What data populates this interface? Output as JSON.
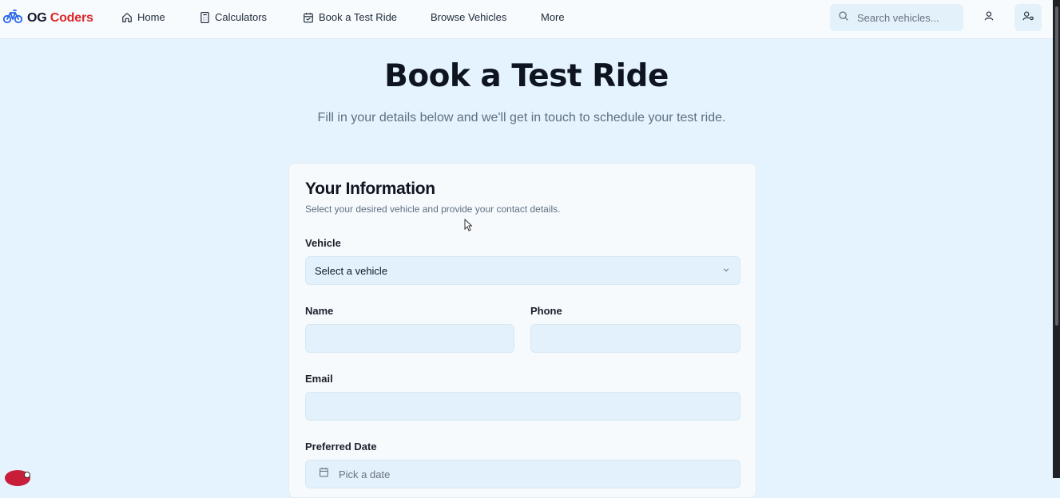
{
  "brand": {
    "part1": "OG",
    "part2": "Coders",
    "icon": "bicycle-icon",
    "accent": "#dc2626",
    "icon_color": "#2563eb"
  },
  "nav": {
    "items": [
      {
        "label": "Home",
        "icon": "home-icon"
      },
      {
        "label": "Calculators",
        "icon": "calculator-icon"
      },
      {
        "label": "Book a Test Ride",
        "icon": "calendar-icon"
      },
      {
        "label": "Browse Vehicles",
        "icon": ""
      },
      {
        "label": "More",
        "icon": ""
      }
    ]
  },
  "search": {
    "placeholder": "Search vehicles...",
    "value": "",
    "icon": "search-icon"
  },
  "header_actions": [
    {
      "icon": "user-icon"
    },
    {
      "icon": "user-settings-icon"
    }
  ],
  "page": {
    "title": "Book a Test Ride",
    "subtitle": "Fill in your details below and we'll get in touch to schedule your test ride."
  },
  "form": {
    "title": "Your Information",
    "subtitle": "Select your desired vehicle and provide your contact details.",
    "vehicle": {
      "label": "Vehicle",
      "value": "Select a vehicle",
      "icon": "chevron-down-icon"
    },
    "name": {
      "label": "Name",
      "value": ""
    },
    "phone": {
      "label": "Phone",
      "value": ""
    },
    "email": {
      "label": "Email",
      "value": ""
    },
    "date": {
      "label": "Preferred Date",
      "placeholder": "Pick a date",
      "icon": "calendar-icon"
    }
  },
  "colors": {
    "background": "#e4f3fd",
    "field_bg": "#e2f1fb",
    "card_bg": "#f6fafd"
  }
}
